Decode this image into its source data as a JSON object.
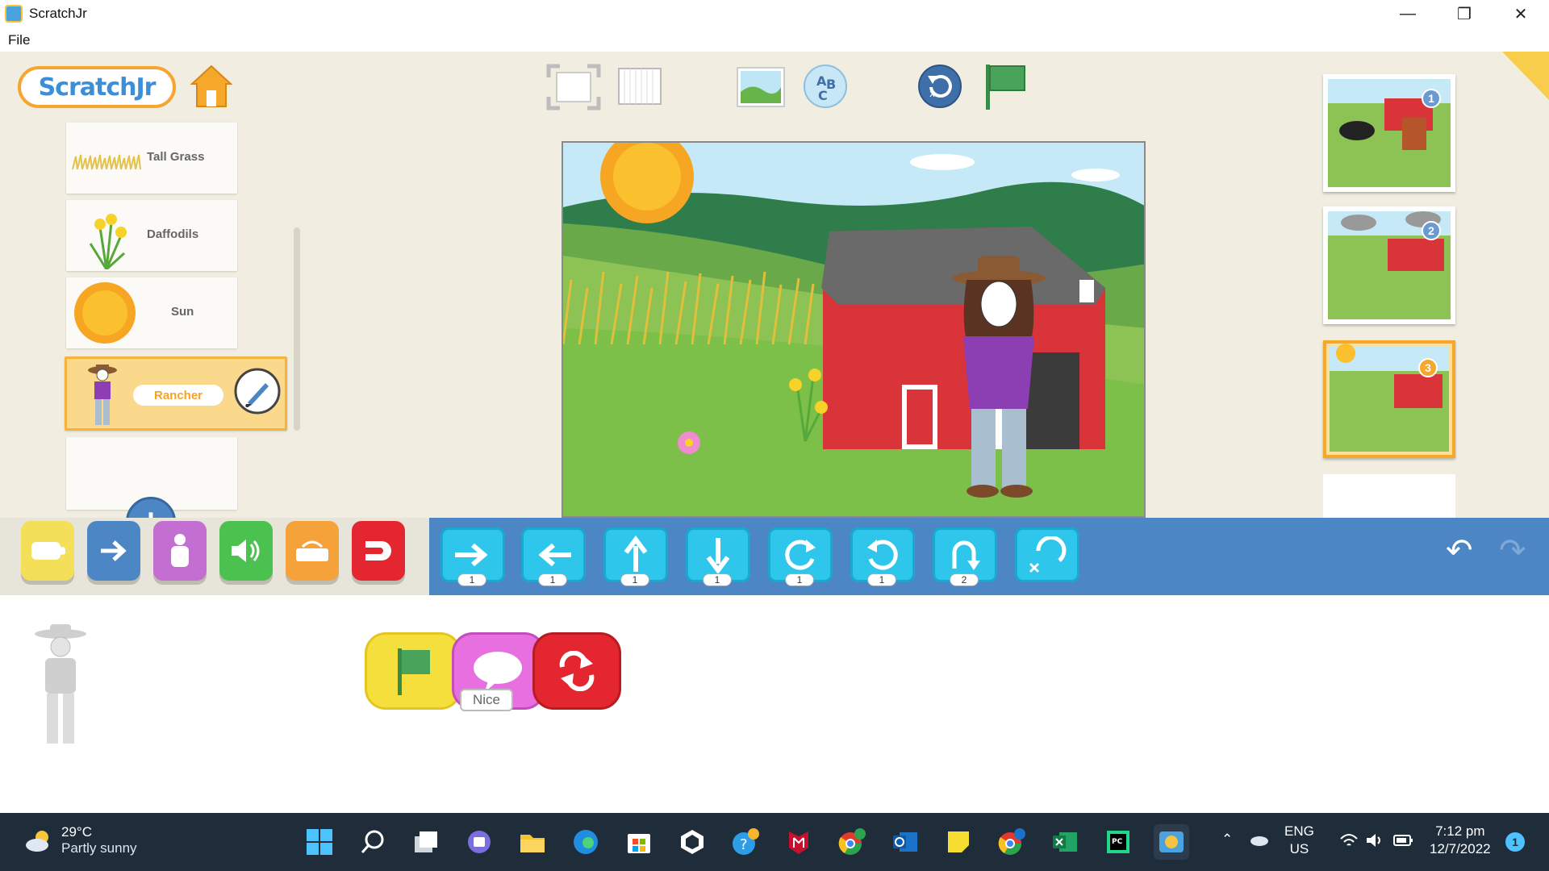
{
  "window": {
    "title": "ScratchJr"
  },
  "menu": {
    "file": "File"
  },
  "logo": {
    "text": "ScratchJr"
  },
  "sprites": [
    {
      "label": "Tall Grass"
    },
    {
      "label": "Daffodils"
    },
    {
      "label": "Sun"
    },
    {
      "label": "Rancher",
      "selected": true
    }
  ],
  "pages": [
    {
      "number": "1"
    },
    {
      "number": "2"
    },
    {
      "number": "3",
      "selected": true
    }
  ],
  "palette": {
    "categories": [
      "triggering",
      "motion",
      "looks",
      "sound",
      "control",
      "end"
    ],
    "motion_blocks": [
      {
        "icon": "move-right-icon",
        "value": "1"
      },
      {
        "icon": "move-left-icon",
        "value": "1"
      },
      {
        "icon": "move-up-icon",
        "value": "1"
      },
      {
        "icon": "move-down-icon",
        "value": "1"
      },
      {
        "icon": "turn-right-icon",
        "value": "1"
      },
      {
        "icon": "turn-left-icon",
        "value": "1"
      },
      {
        "icon": "hop-icon",
        "value": "2"
      },
      {
        "icon": "go-home-icon",
        "value": ""
      }
    ]
  },
  "script": {
    "say_text": "Nice"
  },
  "taskbar": {
    "temp": "29°C",
    "weather": "Partly sunny",
    "lang1": "ENG",
    "lang2": "US",
    "time": "7:12 pm",
    "date": "12/7/2022",
    "notifications": "1"
  },
  "colors": {
    "blocks_bg": "#4d86c5",
    "motion_block": "#2fc6ec",
    "selected_sprite": "#fbd98c"
  }
}
